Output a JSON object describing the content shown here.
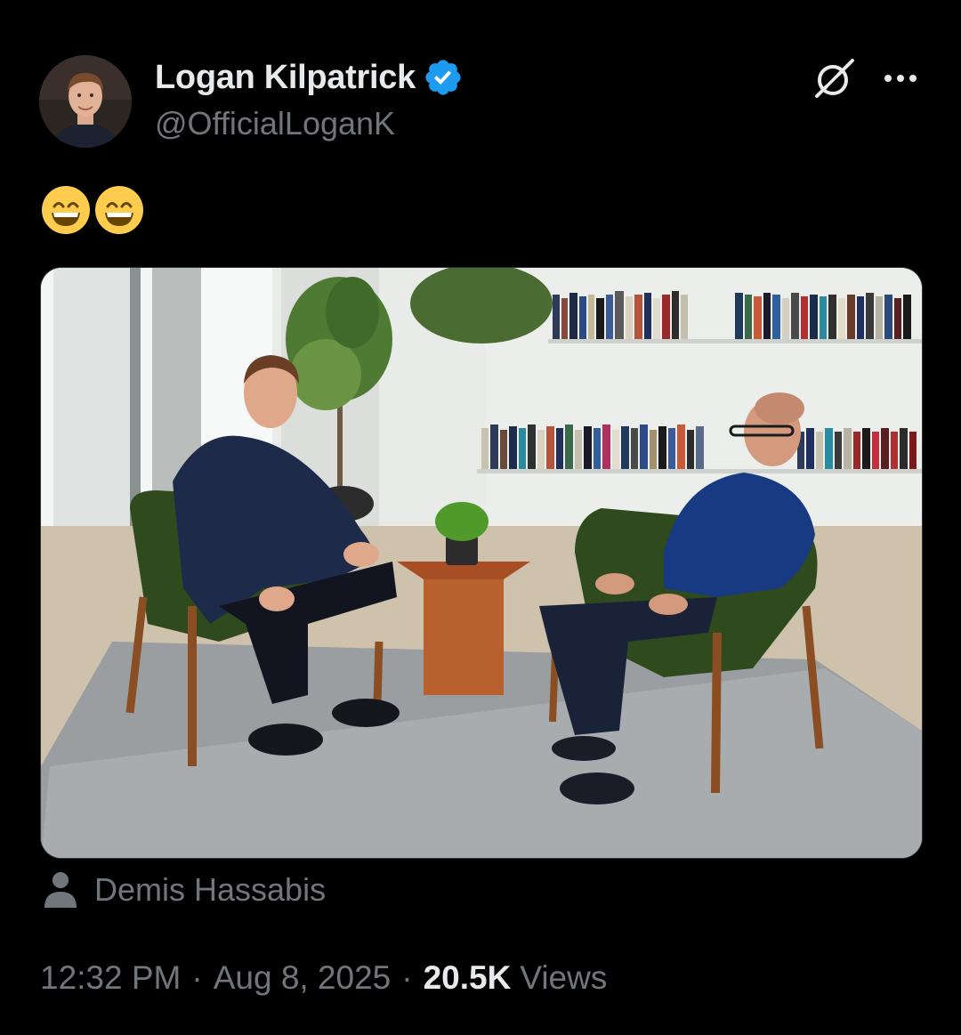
{
  "author": {
    "display_name": "Logan Kilpatrick",
    "handle": "@OfficialLoganK",
    "verified": true,
    "verified_color": "#1d9bf0"
  },
  "post": {
    "text_emojis": [
      "😄",
      "😄"
    ]
  },
  "media": {
    "icon": "photo-two-men-seated-interview"
  },
  "tag": {
    "icon": "person-icon",
    "name": "Demis Hassabis"
  },
  "meta": {
    "time": "12:32 PM",
    "separator": "·",
    "date": "Aug 8, 2025",
    "views_count": "20.5K",
    "views_label": "Views"
  },
  "icons": {
    "grok": "grok-icon",
    "more": "more-dots-icon"
  }
}
